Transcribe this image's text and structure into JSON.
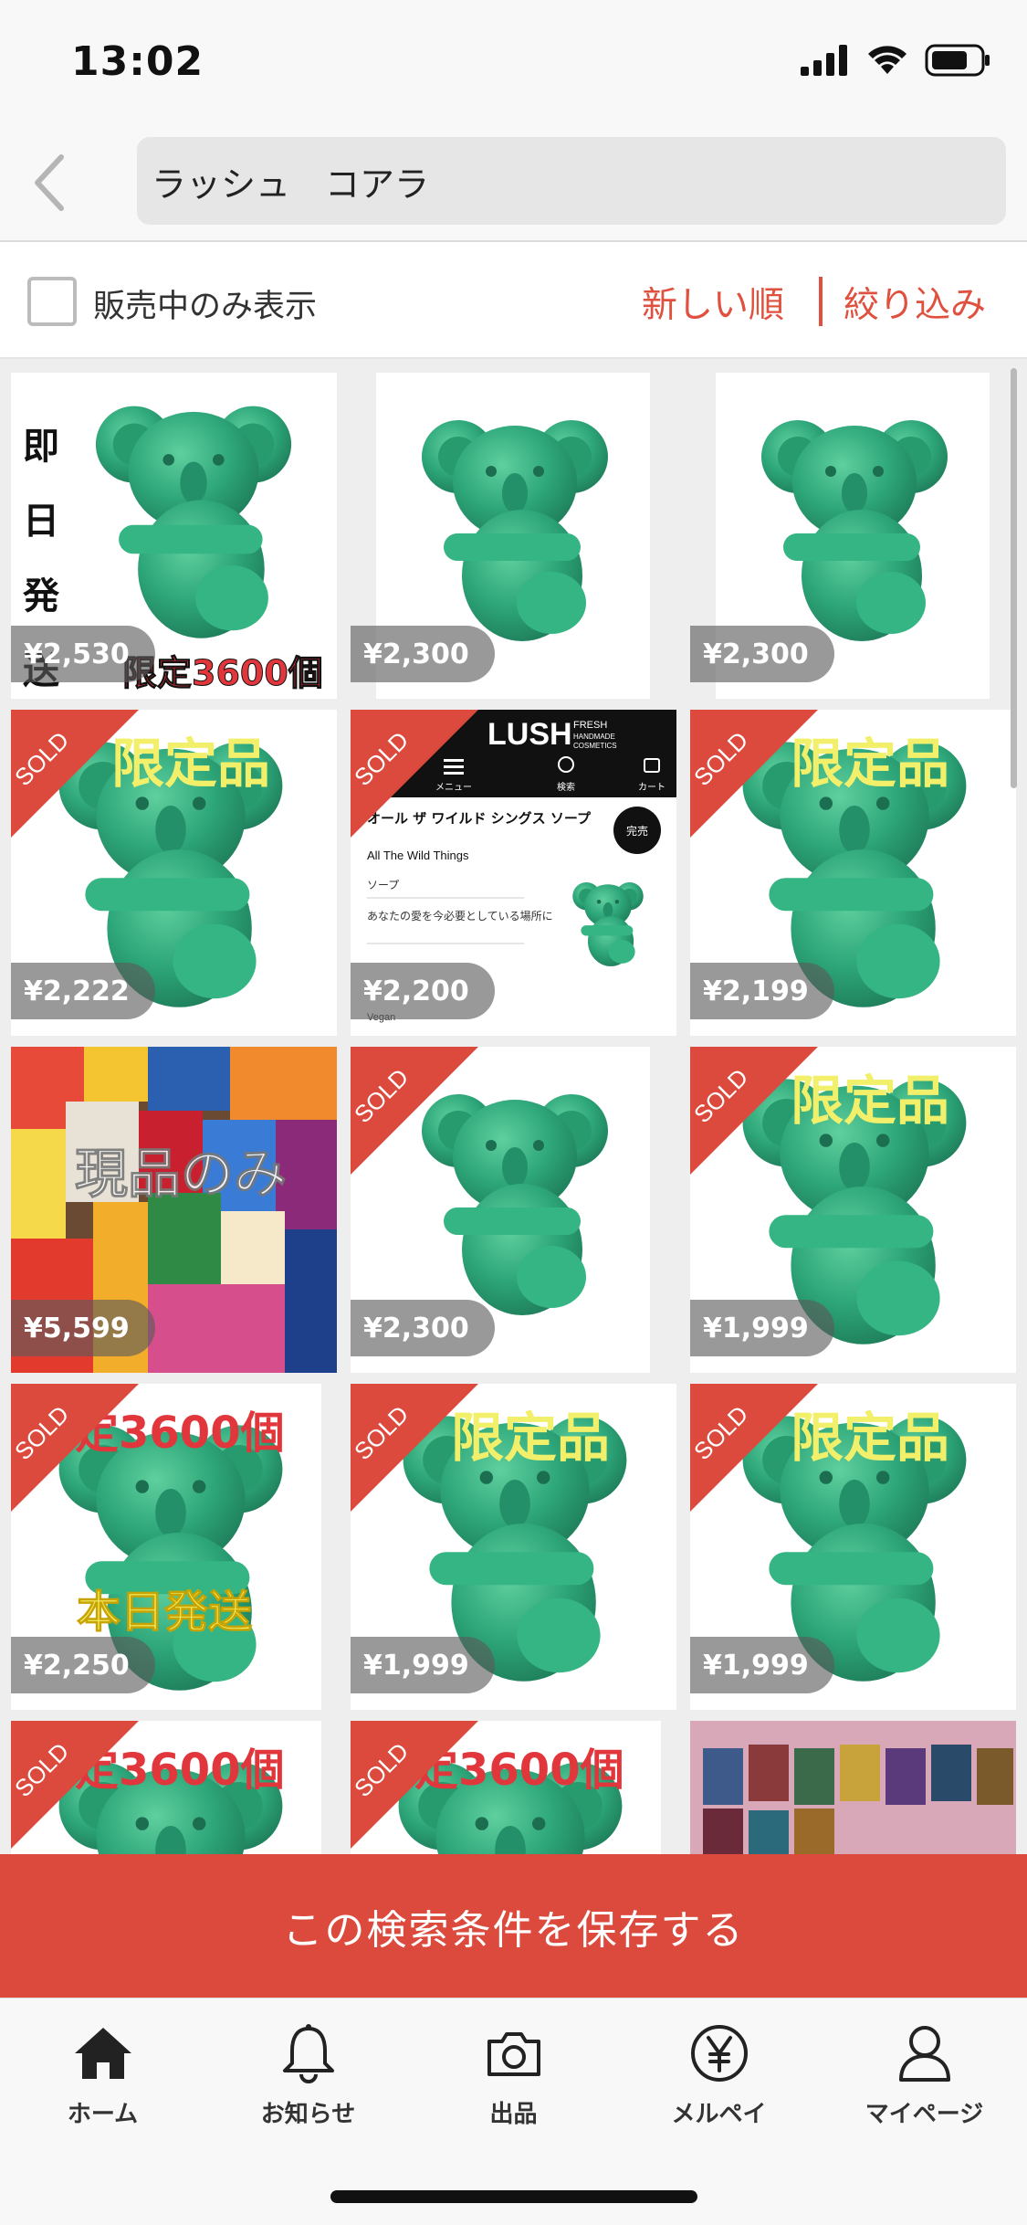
{
  "status_bar": {
    "time": "13:02"
  },
  "search": {
    "query": "ラッシュ　コアラ"
  },
  "filter": {
    "on_sale_only_label": "販売中のみ表示",
    "sort_label": "新しい順",
    "refine_label": "絞り込み"
  },
  "products": [
    {
      "price": "¥2,530",
      "sold": false,
      "overlay": "即日発送 / 限定3600個"
    },
    {
      "price": "¥2,300",
      "sold": false,
      "overlay": ""
    },
    {
      "price": "¥2,300",
      "sold": false,
      "overlay": ""
    },
    {
      "price": "¥2,222",
      "sold": true,
      "overlay": "限定品"
    },
    {
      "price": "¥2,200",
      "sold": true,
      "overlay": "LUSH"
    },
    {
      "price": "¥2,199",
      "sold": true,
      "overlay": "限定品"
    },
    {
      "price": "¥5,599",
      "sold": false,
      "overlay": "現品のみ"
    },
    {
      "price": "¥2,300",
      "sold": true,
      "overlay": ""
    },
    {
      "price": "¥1,999",
      "sold": true,
      "overlay": "限定品"
    },
    {
      "price": "¥2,250",
      "sold": true,
      "overlay": "限定3600個 / 本日発送"
    },
    {
      "price": "¥1,999",
      "sold": true,
      "overlay": "限定品"
    },
    {
      "price": "¥1,999",
      "sold": true,
      "overlay": "限定品"
    },
    {
      "price": "",
      "sold": true,
      "overlay": "限定3600個"
    },
    {
      "price": "",
      "sold": true,
      "overlay": "限定3600個"
    },
    {
      "price": "",
      "sold": false,
      "overlay": ""
    }
  ],
  "overlays": {
    "sokujitsu": [
      "即",
      "日",
      "発",
      "送"
    ],
    "limited_3600": "限定3600個",
    "limited_3600_cut": "定3600個",
    "limited_3600_cut2": "定3600個",
    "limited_item": "限定品",
    "genpin": "現品のみ",
    "honjitsu": "本日発送",
    "sold": "SOLD"
  },
  "lush_card": {
    "brand": "LUSH",
    "brand_sub1": "FRESH",
    "brand_sub2": "HANDMADE",
    "brand_sub3": "COSMETICS",
    "menu": "メニュー",
    "search": "検索",
    "cart": "カート",
    "name_ja": "オール ザ ワイルド シングス ソープ",
    "name_en": "All The Wild Things",
    "category": "ソープ",
    "soldout": "完売",
    "description": "あなたの愛を今必要としている場所に",
    "vegan": "Vegan"
  },
  "save_search_label": "この検索条件を保存する",
  "tabs": [
    {
      "label": "ホーム",
      "icon": "home-icon"
    },
    {
      "label": "お知らせ",
      "icon": "bell-icon"
    },
    {
      "label": "出品",
      "icon": "camera-icon"
    },
    {
      "label": "メルペイ",
      "icon": "yen-icon"
    },
    {
      "label": "マイページ",
      "icon": "person-icon"
    }
  ],
  "colors": {
    "accent": "#dc4a3d",
    "link": "#e0503f",
    "koala": "#2ea77a",
    "overlay_yellow": "#f2f06a"
  }
}
